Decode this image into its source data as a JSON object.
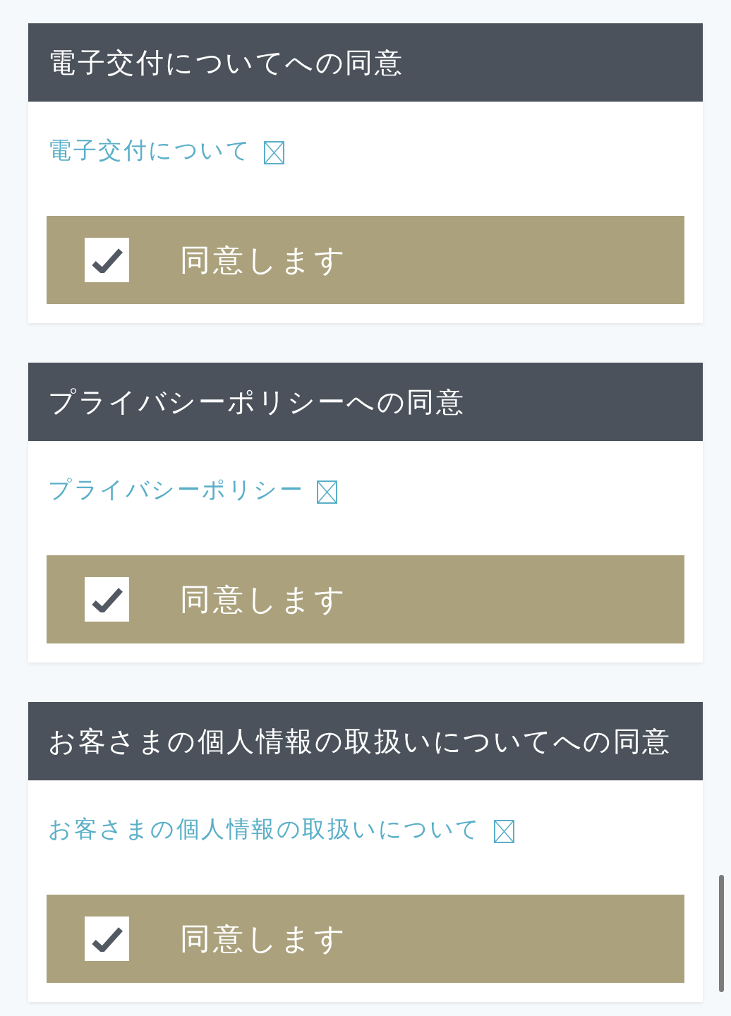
{
  "sections": [
    {
      "title": "電子交付についてへの同意",
      "link": "電子交付について",
      "agree": {
        "label": "同意します",
        "checked": true
      }
    },
    {
      "title": "プライバシーポリシーへの同意",
      "link": "プライバシーポリシー",
      "agree": {
        "label": "同意します",
        "checked": true
      }
    },
    {
      "title": "お客さまの個人情報の取扱いについてへの同意",
      "link": "お客さまの個人情報の取扱いについて",
      "agree": {
        "label": "同意します",
        "checked": true
      }
    }
  ]
}
